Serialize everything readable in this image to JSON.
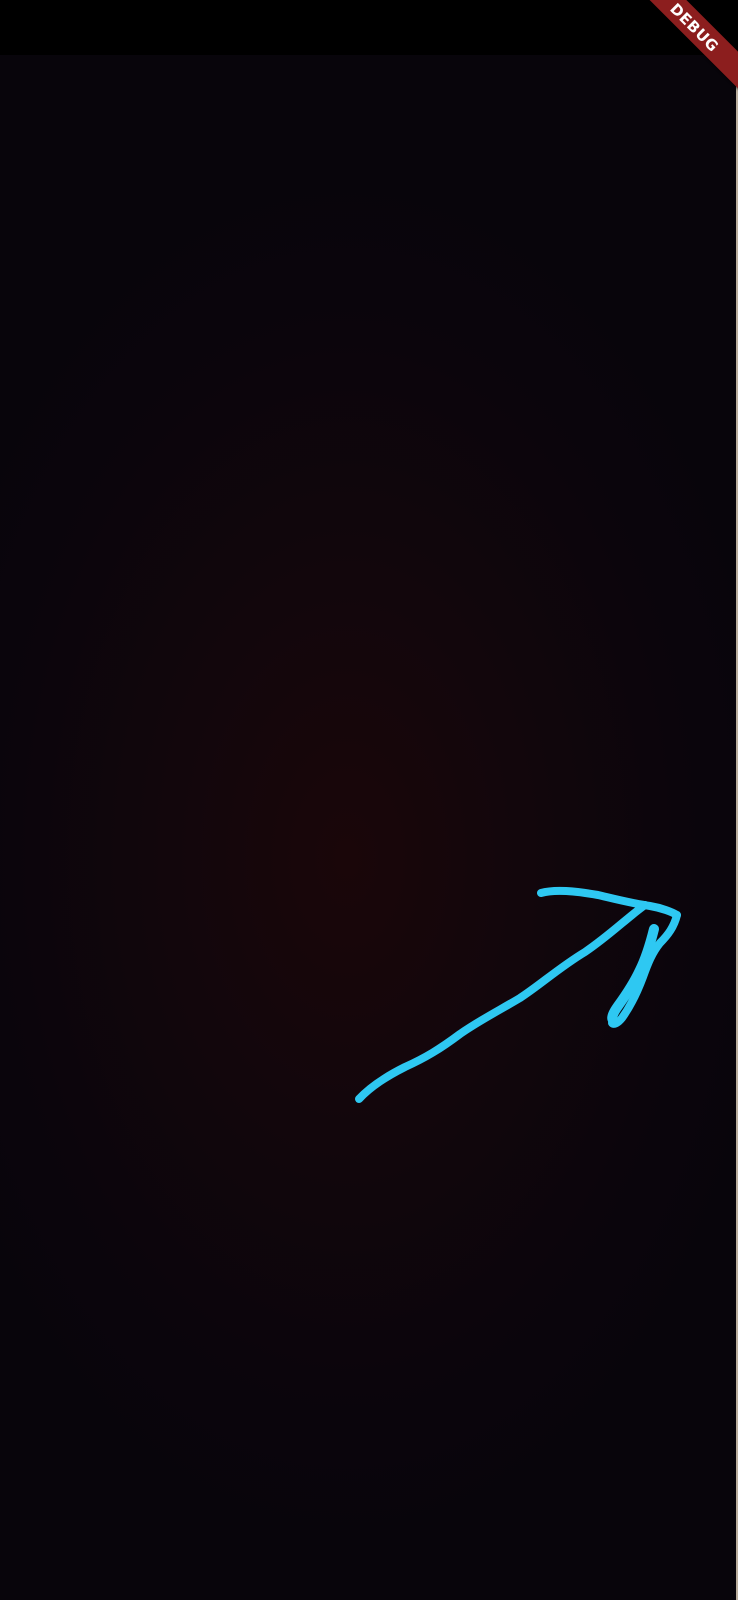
{
  "banner": {
    "label": "DEBUG",
    "color": "#8c1e1e"
  },
  "canvas": {
    "stroke_color": "#2ec8f2",
    "drawing": "arrow-stroke"
  }
}
